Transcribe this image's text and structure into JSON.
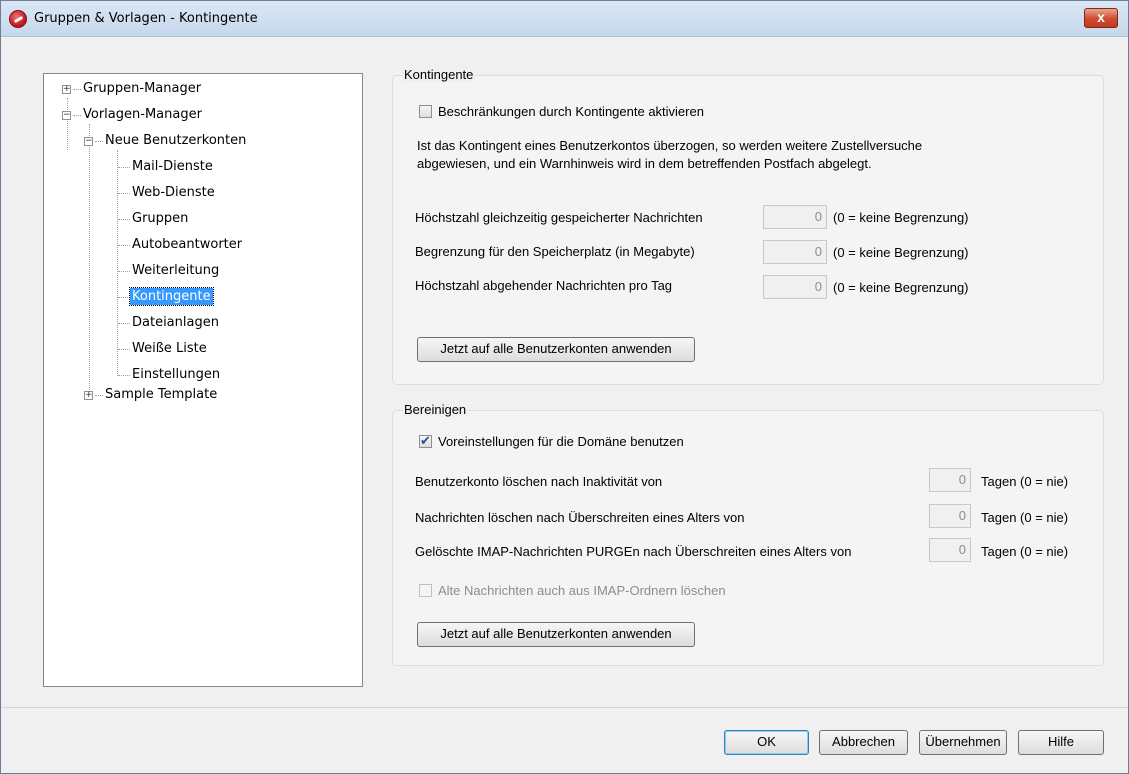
{
  "window": {
    "title": "Gruppen & Vorlagen - Kontingente",
    "close_label": "x"
  },
  "tree": {
    "groups_manager": "Gruppen-Manager",
    "templates_manager": "Vorlagen-Manager",
    "new_accounts": "Neue Benutzerkonten",
    "children": [
      "Mail-Dienste",
      "Web-Dienste",
      "Gruppen",
      "Autobeantworter",
      "Weiterleitung",
      "Kontingente",
      "Dateianlagen",
      "Weiße Liste",
      "Einstellungen"
    ],
    "sample_template": "Sample Template",
    "selected": "Kontingente"
  },
  "quotas": {
    "title": "Kontingente",
    "enable_label": "Beschränkungen durch Kontingente aktivieren",
    "enable_checked": false,
    "description_line1": "Ist das Kontingent eines Benutzerkontos überzogen, so werden weitere Zustellversuche",
    "description_line2": "abgewiesen, und ein Warnhinweis wird in dem betreffenden Postfach abgelegt.",
    "rows": [
      {
        "label": "Höchstzahl gleichzeitig gespeicherter Nachrichten",
        "value": "0",
        "hint": "(0 = keine Begrenzung)"
      },
      {
        "label": "Begrenzung für den Speicherplatz (in Megabyte)",
        "value": "0",
        "hint": "(0 = keine Begrenzung)"
      },
      {
        "label": "Höchstzahl abgehender Nachrichten pro Tag",
        "value": "0",
        "hint": "(0 = keine Begrenzung)"
      }
    ],
    "apply_button": "Jetzt auf alle Benutzerkonten anwenden"
  },
  "cleanup": {
    "title": "Bereinigen",
    "use_domain_defaults_label": "Voreinstellungen für die Domäne benutzen",
    "use_domain_defaults_checked": true,
    "rows": [
      {
        "label": "Benutzerkonto löschen nach Inaktivität von",
        "value": "0",
        "unit": "Tagen (0 = nie)"
      },
      {
        "label": "Nachrichten löschen nach Überschreiten eines Alters von",
        "value": "0",
        "unit": "Tagen (0 = nie)"
      },
      {
        "label": "Gelöschte IMAP-Nachrichten PURGEn nach Überschreiten eines Alters von",
        "value": "0",
        "unit": "Tagen (0 = nie)"
      }
    ],
    "imap_label": "Alte Nachrichten auch aus IMAP-Ordnern löschen",
    "imap_checked": false,
    "apply_button": "Jetzt auf alle Benutzerkonten anwenden"
  },
  "footer": {
    "ok": "OK",
    "cancel": "Abbrechen",
    "apply": "Übernehmen",
    "help": "Hilfe"
  }
}
